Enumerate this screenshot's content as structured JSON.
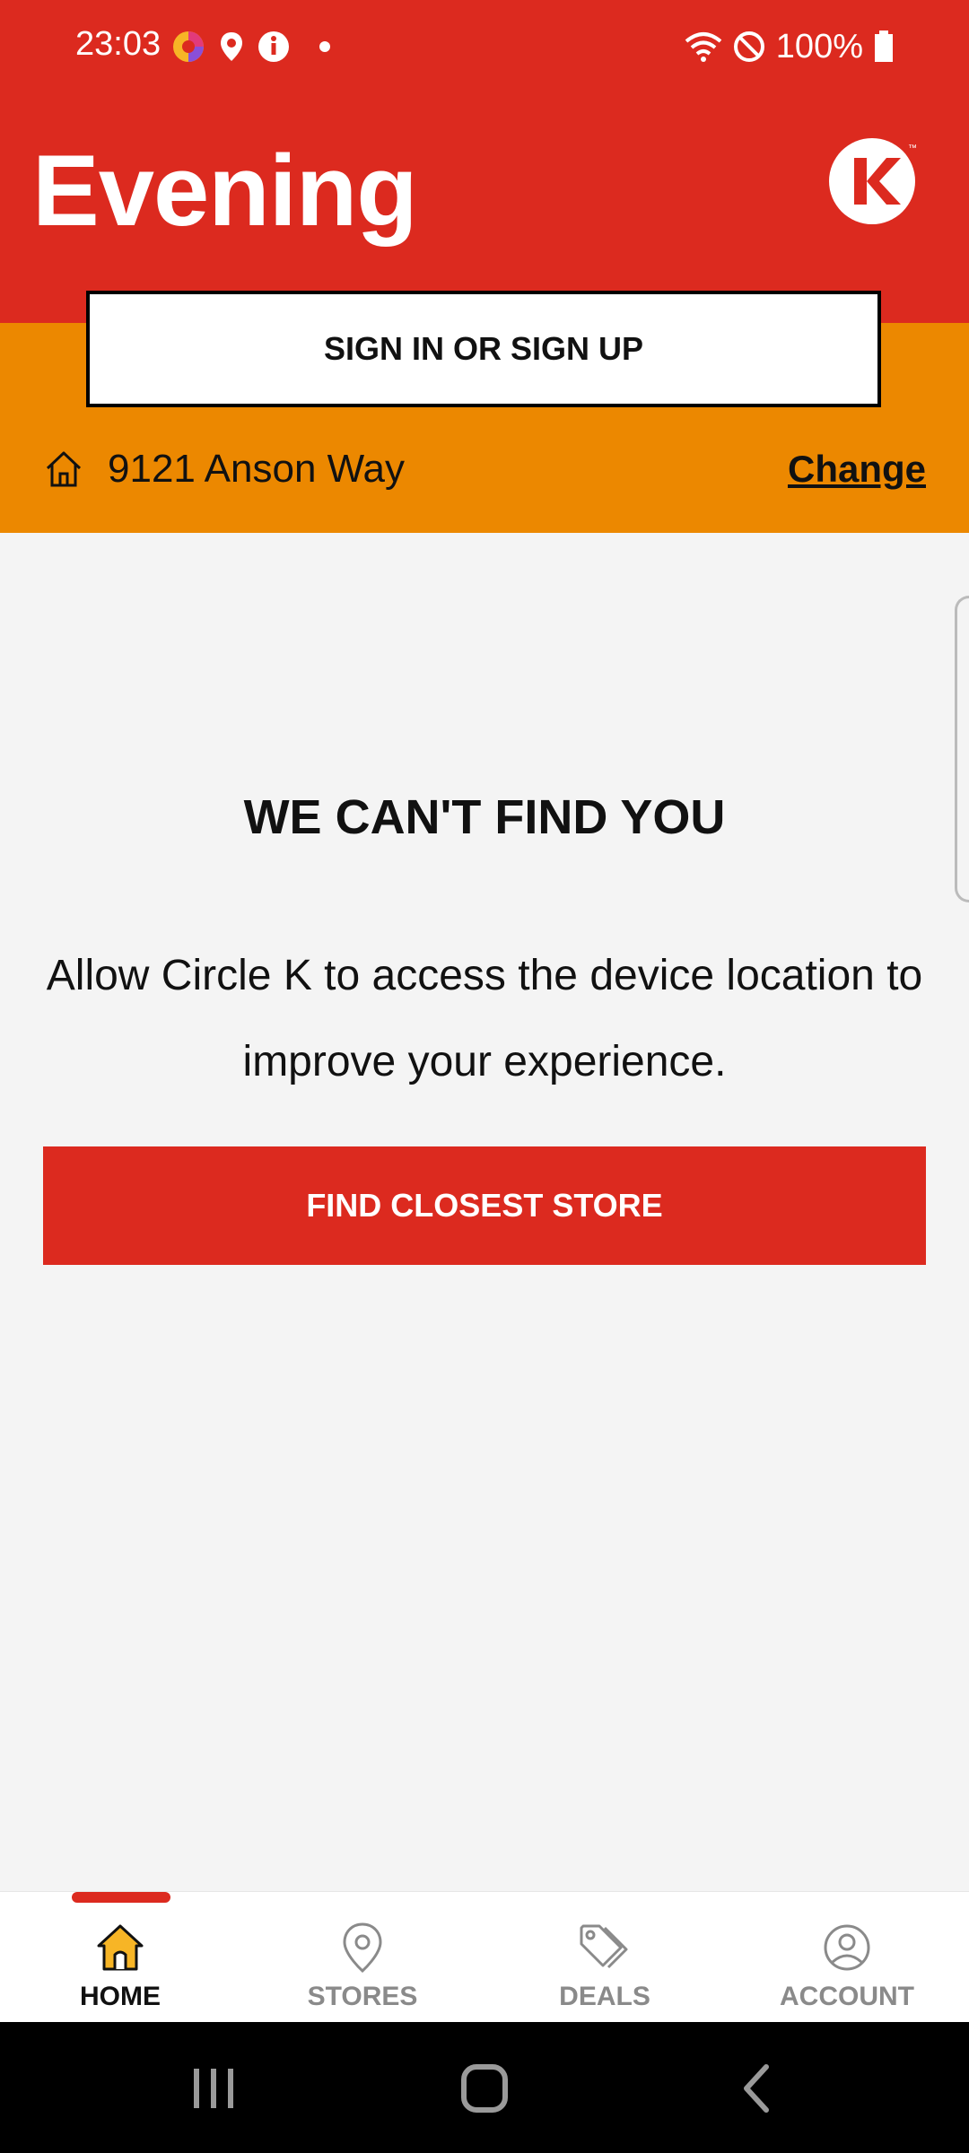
{
  "status_bar": {
    "time": "23:03",
    "battery": "100%",
    "left_icons": [
      "app-notification-icon",
      "location-icon",
      "info-icon",
      "dot-icon"
    ],
    "right_icons": [
      "wifi-icon",
      "do-not-disturb-icon",
      "battery-icon"
    ]
  },
  "header": {
    "greeting": "Evening",
    "logo_icon": "circle-k-logo",
    "background_color": "#dc2a1f"
  },
  "account_band": {
    "sign_in_label": "SIGN IN OR SIGN UP",
    "address": "9121 Anson Way",
    "change_label": "Change",
    "background_color": "#ec8800"
  },
  "main": {
    "title": "WE CAN'T FIND YOU",
    "message": "Allow Circle K to access the device location to improve your experience.",
    "cta_label": "FIND CLOSEST STORE"
  },
  "bottom_nav": {
    "items": [
      {
        "label": "HOME",
        "icon": "home-icon",
        "active": true
      },
      {
        "label": "STORES",
        "icon": "location-pin-icon",
        "active": false
      },
      {
        "label": "DEALS",
        "icon": "tag-icon",
        "active": false
      },
      {
        "label": "ACCOUNT",
        "icon": "user-circle-icon",
        "active": false
      }
    ]
  },
  "android_nav": {
    "buttons": [
      "recents-icon",
      "home-button-icon",
      "back-icon"
    ]
  },
  "colors": {
    "brand_red": "#dc2a1f",
    "brand_orange": "#ec8800",
    "active_icon_fill": "#f7b526"
  }
}
